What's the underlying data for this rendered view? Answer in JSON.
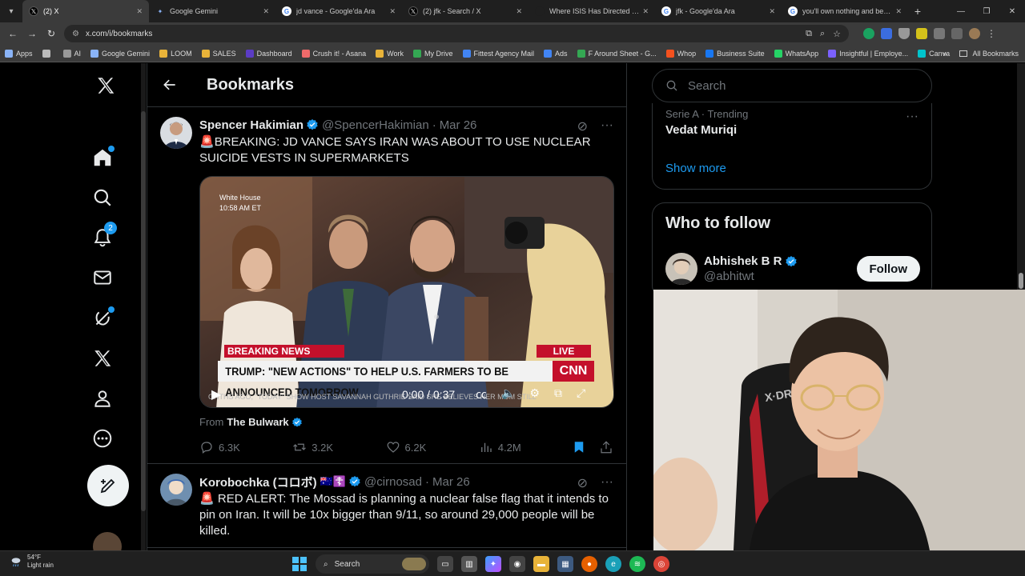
{
  "browser": {
    "tabs": [
      {
        "title": "(2) X",
        "favicon": "x-icon",
        "active": true
      },
      {
        "title": "Google Gemini",
        "favicon": "gemini-icon",
        "active": false
      },
      {
        "title": "jd vance - Google'da Ara",
        "favicon": "google-icon",
        "active": false
      },
      {
        "title": "(2) jfk - Search / X",
        "favicon": "x-icon",
        "active": false
      },
      {
        "title": "Where ISIS Has Directed and In",
        "favicon": "page-icon",
        "active": false
      },
      {
        "title": "jfk - Google'da Ara",
        "favicon": "google-icon",
        "active": false
      },
      {
        "title": "you'll own nothing and be hap",
        "favicon": "google-icon",
        "active": false
      }
    ],
    "url": "x.com/i/bookmarks",
    "bookmarks": [
      {
        "label": "Apps",
        "color": "#8ab4f8"
      },
      {
        "label": "",
        "color": "#bbbbbb"
      },
      {
        "label": "AI",
        "color": "#999999"
      },
      {
        "label": "Google Gemini",
        "color": "#8ab4f8"
      },
      {
        "label": "LOOM",
        "color": "#e8b339"
      },
      {
        "label": "SALES",
        "color": "#e8b339"
      },
      {
        "label": "Dashboard",
        "color": "#5b3cc4"
      },
      {
        "label": "Crush it! - Asana",
        "color": "#f06a6a"
      },
      {
        "label": "Work",
        "color": "#e8b339"
      },
      {
        "label": "My Drive",
        "color": "#34a853"
      },
      {
        "label": "Fittest Agency Mail",
        "color": "#4285f4"
      },
      {
        "label": "Ads",
        "color": "#4285f4"
      },
      {
        "label": "F Around Sheet - G...",
        "color": "#34a853"
      },
      {
        "label": "Whop",
        "color": "#f4511e"
      },
      {
        "label": "Business Suite",
        "color": "#1877f2"
      },
      {
        "label": "WhatsApp",
        "color": "#25d366"
      },
      {
        "label": "Insightful | Employe...",
        "color": "#7b61ff"
      },
      {
        "label": "Canva",
        "color": "#00c4cc"
      }
    ],
    "all_bookmarks_label": "All Bookmarks"
  },
  "nav": {
    "notifications_count": "2"
  },
  "header": {
    "title": "Bookmarks"
  },
  "tweets": [
    {
      "name": "Spencer Hakimian",
      "handle": "@SpencerHakimian",
      "date": "Mar 26",
      "text": "BREAKING: JD VANCE SAYS IRAN WAS ABOUT TO USE NUCLEAR SUICIDE VESTS IN SUPERMARKETS",
      "media": {
        "location_label": "White House",
        "time_label": "10:58 AM ET",
        "breaking_label": "BREAKING NEWS",
        "live_label": "LIVE",
        "headline": "TRUMP: \"NEW ACTIONS\" TO HELP U.S. FARMERS TO BE ANNOUNCED TOMORROW",
        "network": "CNN",
        "ticker": "ONTHS AGO, \"TODAY\" SHOW HOST SAVANNAH GUTHRIE SAID SHE BELIEVES HER MOM STILL",
        "time": "0:00 / 0:37"
      },
      "from_label": "From",
      "from_name": "The Bulwark",
      "replies": "6.3K",
      "reposts": "3.2K",
      "likes": "6.2K",
      "views": "4.2M"
    },
    {
      "name": "Korobochka (コロボ)",
      "flags": "🇦🇺☦️",
      "handle": "@cirnosad",
      "date": "Mar 26",
      "text": "RED ALERT: The Mossad is planning a nuclear false flag that it intends to pin on Iran. It will be 10x bigger than 9/11, so around 29,000 people will be killed."
    }
  ],
  "sidebar": {
    "search_placeholder": "Search",
    "trend_meta": "Serie A · Trending",
    "trend_name": "Vedat Muriqi",
    "show_more": "Show more",
    "who_to_follow_title": "Who to follow",
    "suggestion": {
      "name": "Abhishek B R",
      "handle": "@abhitwt",
      "follow_label": "Follow"
    }
  },
  "taskbar": {
    "temperature": "54°F",
    "weather": "Light rain",
    "search_label": "Search"
  },
  "colors": {
    "accent": "#1d9bf0",
    "background": "#000000",
    "text": "#e7e9ea",
    "muted": "#71767b",
    "cnn_red": "#c4102b"
  }
}
